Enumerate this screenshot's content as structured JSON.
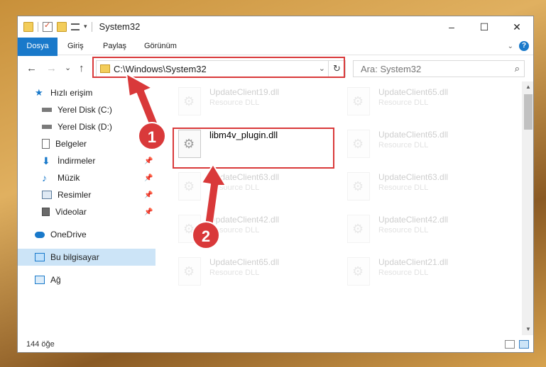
{
  "window": {
    "title": "System32",
    "controls": [
      "–",
      "☐",
      "✕"
    ]
  },
  "ribbon": {
    "tabs": [
      "Dosya",
      "Giriş",
      "Paylaş",
      "Görünüm"
    ]
  },
  "nav": {
    "back": "←",
    "forward": "→",
    "recent": "⌄",
    "up": "↑",
    "address": "C:\\Windows\\System32",
    "refresh": "↻",
    "search_placeholder": "Ara: System32"
  },
  "sidebar": {
    "items": [
      {
        "label": "Hızlı erişim",
        "icon": "star-icon"
      },
      {
        "label": "Yerel Disk (C:)",
        "icon": "drive-icon"
      },
      {
        "label": "Yerel Disk (D:)",
        "icon": "drive-icon"
      },
      {
        "label": "Belgeler",
        "icon": "documents-icon"
      },
      {
        "label": "İndirmeler",
        "icon": "download-icon"
      },
      {
        "label": "Müzik",
        "icon": "music-icon"
      },
      {
        "label": "Resimler",
        "icon": "pictures-icon"
      },
      {
        "label": "Videolar",
        "icon": "video-icon"
      },
      {
        "label": "OneDrive",
        "icon": "cloud-icon"
      },
      {
        "label": "Bu bilgisayar",
        "icon": "computer-icon"
      },
      {
        "label": "Ağ",
        "icon": "network-icon"
      }
    ]
  },
  "files": [
    {
      "name": "UpdateClient19.dll",
      "type": "Resource DLL"
    },
    {
      "name": "UpdateClient65.dll",
      "type": "Resource DLL"
    },
    {
      "name": "libm4v_plugin.dll",
      "type": ""
    },
    {
      "name": "UpdateClient65.dll",
      "type": "Resource DLL"
    },
    {
      "name": "UpdateClient63.dll",
      "type": "Resource DLL"
    },
    {
      "name": "UpdateClient63.dll",
      "type": "Resource DLL"
    },
    {
      "name": "UpdateClient42.dll",
      "type": "Resource DLL"
    },
    {
      "name": "UpdateClient42.dll",
      "type": "Resource DLL"
    },
    {
      "name": "UpdateClient65.dll",
      "type": "Resource DLL"
    },
    {
      "name": "UpdateClient21.dll",
      "type": "Resource DLL"
    }
  ],
  "status": {
    "item_count": "144 öğe"
  },
  "annotations": {
    "step1": "1",
    "step2": "2",
    "color": "#d9393a"
  }
}
